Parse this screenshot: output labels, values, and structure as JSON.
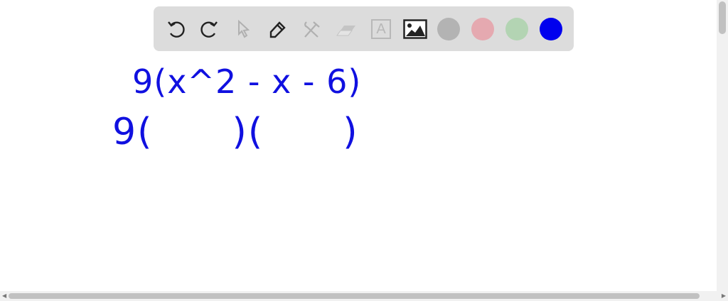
{
  "toolbar": {
    "tools": [
      {
        "name": "undo",
        "icon": "undo-icon",
        "enabled": true
      },
      {
        "name": "redo",
        "icon": "redo-icon",
        "enabled": true
      },
      {
        "name": "select",
        "icon": "cursor-icon",
        "enabled": false
      },
      {
        "name": "pen",
        "icon": "pencil-icon",
        "enabled": true,
        "active": true
      },
      {
        "name": "tools",
        "icon": "tools-icon",
        "enabled": false
      },
      {
        "name": "eraser",
        "icon": "eraser-icon",
        "enabled": false
      },
      {
        "name": "text",
        "icon": "text-icon",
        "enabled": false,
        "glyph": "A"
      },
      {
        "name": "image",
        "icon": "image-icon",
        "enabled": true
      }
    ],
    "colors": [
      "#b3b3b3",
      "#e5a9b0",
      "#b3d4b3",
      "#0000ee"
    ],
    "selected_color": "#0000ee"
  },
  "canvas": {
    "ink_color": "#1010e0",
    "handwriting": [
      "9(x^2 - x - 6)",
      "9(      )(      )"
    ]
  }
}
